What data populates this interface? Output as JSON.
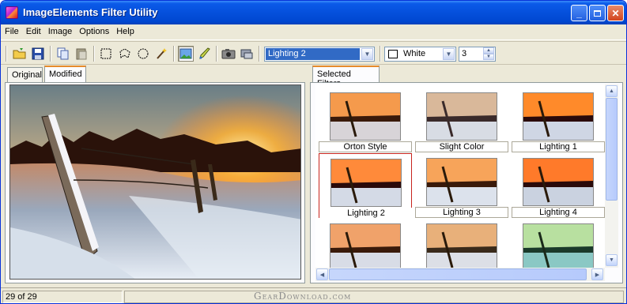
{
  "window": {
    "title": "ImageElements Filter Utility",
    "controls": [
      "minimize",
      "maximize",
      "close"
    ]
  },
  "menu": [
    "File",
    "Edit",
    "Image",
    "Options",
    "Help"
  ],
  "toolbar": {
    "buttons": [
      "open-icon",
      "save-icon",
      "copy-icon",
      "paste-icon",
      "rect-select-icon",
      "lasso-icon",
      "ellipse-select-icon",
      "magic-wand-icon",
      "image-icon",
      "brush-icon",
      "camera-icon",
      "scanner-icon"
    ],
    "filter_combo": "Lighting 2",
    "color_combo": "White",
    "spin_value": "3"
  },
  "left_panel": {
    "tabs": [
      "Original",
      "Modified"
    ],
    "active_tab": "Modified"
  },
  "right_panel": {
    "tabs": [
      "Selected Filters"
    ],
    "filters": [
      {
        "label": "Orton Style",
        "tint": "#f59a4c"
      },
      {
        "label": "Slight Color",
        "tint": "#d9b89a"
      },
      {
        "label": "Lighting 1",
        "tint": "#ff8a2a"
      },
      {
        "label": "Lighting 2",
        "tint": "#ff8a3a",
        "selected": true
      },
      {
        "label": "Lighting 3",
        "tint": "#f7a45a"
      },
      {
        "label": "Lighting 4",
        "tint": "#ff7a2a"
      },
      {
        "label": "",
        "tint": "#f0a26a"
      },
      {
        "label": "",
        "tint": "#e8b07a"
      },
      {
        "label": "",
        "tint": "#b8e0a0"
      }
    ]
  },
  "status": {
    "position": "29 of 29",
    "watermark": "GearDownload.com"
  }
}
